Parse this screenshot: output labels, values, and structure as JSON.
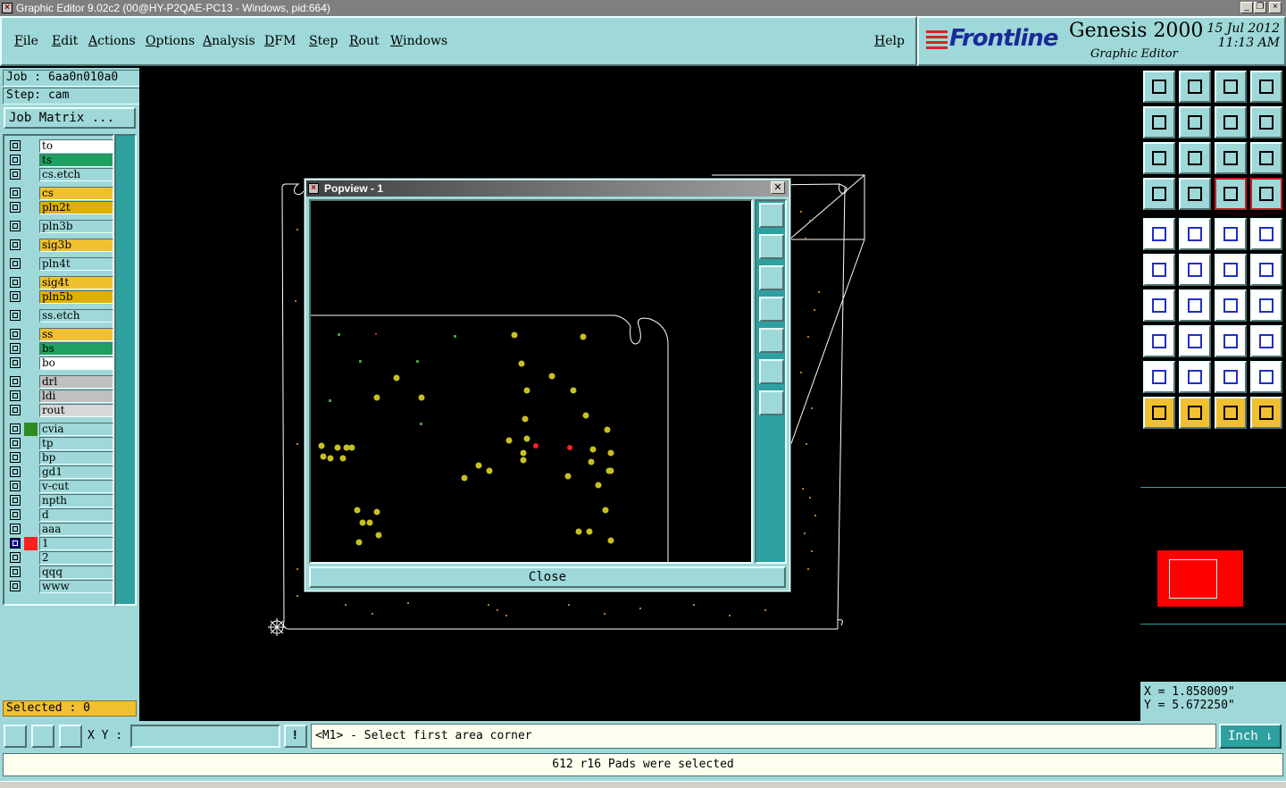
{
  "window": {
    "title": "Graphic Editor 9.02c2 (00@HY-P2QAE-PC13 - Windows, pid:664)"
  },
  "menu": [
    "File",
    "Edit",
    "Actions",
    "Options",
    "Analysis",
    "DFM",
    "Step",
    "Rout",
    "Windows"
  ],
  "help_label": "Help",
  "brand": {
    "logo": "Frontline",
    "product": "Genesis 2000",
    "subtitle": "Graphic Editor",
    "date": "15 Jul 2012",
    "time": "11:13 AM"
  },
  "job": {
    "job_label": "Job : 6aa0n010a0",
    "step_label": "Step: cam",
    "matrix_button": "Job Matrix ..."
  },
  "layers": [
    {
      "name": "to",
      "color": "#ffffff",
      "gap": false
    },
    {
      "name": "ts",
      "color": "#20a060",
      "gap": false
    },
    {
      "name": "cs.etch",
      "color": "#9fd8d8",
      "gap": false
    },
    {
      "name": "cs",
      "color": "#f0c030",
      "gap": true
    },
    {
      "name": "pln2t",
      "color": "#e0b000",
      "gap": false
    },
    {
      "name": "pln3b",
      "color": "#9fd8d8",
      "gap": true
    },
    {
      "name": "sig3b",
      "color": "#f0c030",
      "gap": true
    },
    {
      "name": "pln4t",
      "color": "#9fd8d8",
      "gap": true
    },
    {
      "name": "sig4t",
      "color": "#f0c030",
      "gap": true
    },
    {
      "name": "pln5b",
      "color": "#e0b000",
      "gap": false
    },
    {
      "name": "ss.etch",
      "color": "#9fd8d8",
      "gap": true
    },
    {
      "name": "ss",
      "color": "#f0c030",
      "gap": true
    },
    {
      "name": "bs",
      "color": "#20a060",
      "gap": false
    },
    {
      "name": "bo",
      "color": "#ffffff",
      "gap": false
    },
    {
      "name": "drl",
      "color": "#c0c0c0",
      "gap": true
    },
    {
      "name": "ldi",
      "color": "#c0c0c0",
      "gap": false
    },
    {
      "name": "rout",
      "color": "#d8d8d8",
      "gap": false
    },
    {
      "name": "cvia",
      "color": "#9fd8d8",
      "gap": true,
      "swatch": "#2e8b20"
    },
    {
      "name": "tp",
      "color": "#9fd8d8",
      "gap": false
    },
    {
      "name": "bp",
      "color": "#9fd8d8",
      "gap": false
    },
    {
      "name": "gd1",
      "color": "#9fd8d8",
      "gap": false
    },
    {
      "name": "v-cut",
      "color": "#9fd8d8",
      "gap": false
    },
    {
      "name": "npth",
      "color": "#9fd8d8",
      "gap": false
    },
    {
      "name": "d",
      "color": "#9fd8d8",
      "gap": false
    },
    {
      "name": "aaa",
      "color": "#9fd8d8",
      "gap": false
    },
    {
      "name": "1",
      "color": "#9fd8d8",
      "gap": false,
      "swatch": "#ff2020",
      "active": true
    },
    {
      "name": "2",
      "color": "#9fd8d8",
      "gap": false
    },
    {
      "name": "qqq",
      "color": "#9fd8d8",
      "gap": false
    },
    {
      "name": "www",
      "color": "#9fd8d8",
      "gap": false
    }
  ],
  "selected_label": "Selected : 0",
  "coordinates": {
    "x": "X = 1.858009\"",
    "y": "Y = 5.672250\""
  },
  "bottom": {
    "xy_label": "X Y :",
    "xy_value": "",
    "prompt": "<M1> - Select first area corner",
    "units": "Inch"
  },
  "status_message": "612 r16 Pads were selected",
  "popview": {
    "title": "Popview - 1",
    "close_label": "Close"
  },
  "colors": {
    "panel": "#9fd8d8",
    "accent": "#2ea0a0",
    "pad": "#c8c020",
    "selected_pad": "#ff2020"
  }
}
